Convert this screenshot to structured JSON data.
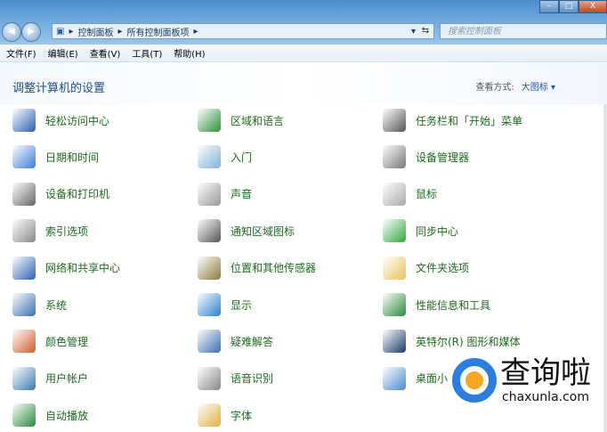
{
  "window": {
    "minimize": "–",
    "maximize": "□",
    "close": "X"
  },
  "address": {
    "crumbs": [
      "控制面板",
      "所有控制面板项"
    ],
    "search_placeholder": "搜索控制面板"
  },
  "menu": [
    "文件(F)",
    "编辑(E)",
    "查看(V)",
    "工具(T)",
    "帮助(H)"
  ],
  "header": {
    "title": "调整计算机的设置",
    "view_by_label": "查看方式:",
    "view_by_value": "大图标"
  },
  "items": [
    {
      "label": "轻松访问中心",
      "icon": "ease-of-access-icon",
      "color": "#2a5fb0"
    },
    {
      "label": "区域和语言",
      "icon": "globe-icon",
      "color": "#2f8f3a"
    },
    {
      "label": "任务栏和「开始」菜单",
      "icon": "taskbar-icon",
      "color": "#555"
    },
    {
      "label": "日期和时间",
      "icon": "calendar-icon",
      "color": "#3a7bd5"
    },
    {
      "label": "入门",
      "icon": "getting-started-icon",
      "color": "#7fb2d8"
    },
    {
      "label": "设备管理器",
      "icon": "device-manager-icon",
      "color": "#777"
    },
    {
      "label": "设备和打印机",
      "icon": "printer-icon",
      "color": "#666"
    },
    {
      "label": "声音",
      "icon": "speaker-icon",
      "color": "#999"
    },
    {
      "label": "鼠标",
      "icon": "mouse-icon",
      "color": "#aaa"
    },
    {
      "label": "索引选项",
      "icon": "index-search-icon",
      "color": "#888"
    },
    {
      "label": "通知区域图标",
      "icon": "notification-icon",
      "color": "#555"
    },
    {
      "label": "同步中心",
      "icon": "sync-icon",
      "color": "#2fa83a"
    },
    {
      "label": "网络和共享中心",
      "icon": "network-icon",
      "color": "#2a5fb0"
    },
    {
      "label": "位置和其他传感器",
      "icon": "sensor-icon",
      "color": "#8a7a3a"
    },
    {
      "label": "文件夹选项",
      "icon": "folder-icon",
      "color": "#e8c35a"
    },
    {
      "label": "系统",
      "icon": "system-icon",
      "color": "#3a6fb0"
    },
    {
      "label": "显示",
      "icon": "display-icon",
      "color": "#2a7fd0"
    },
    {
      "label": "性能信息和工具",
      "icon": "performance-icon",
      "color": "#2a8a3a"
    },
    {
      "label": "颜色管理",
      "icon": "color-management-icon",
      "color": "#d05a2a"
    },
    {
      "label": "疑难解答",
      "icon": "troubleshoot-icon",
      "color": "#3a6fb0"
    },
    {
      "label": "英特尔(R) 图形和媒体",
      "icon": "intel-graphics-icon",
      "color": "#1a3a6a"
    },
    {
      "label": "用户帐户",
      "icon": "users-icon",
      "color": "#3a7ab0"
    },
    {
      "label": "语音识别",
      "icon": "microphone-icon",
      "color": "#888"
    },
    {
      "label": "桌面小",
      "icon": "gadgets-icon",
      "color": "#4a8ad0"
    },
    {
      "label": "自动播放",
      "icon": "autoplay-icon",
      "color": "#2a8a3a"
    },
    {
      "label": "字体",
      "icon": "fonts-icon",
      "color": "#e0b040"
    }
  ],
  "watermark": {
    "cn": "查询啦",
    "en": "chaxunla.com"
  }
}
